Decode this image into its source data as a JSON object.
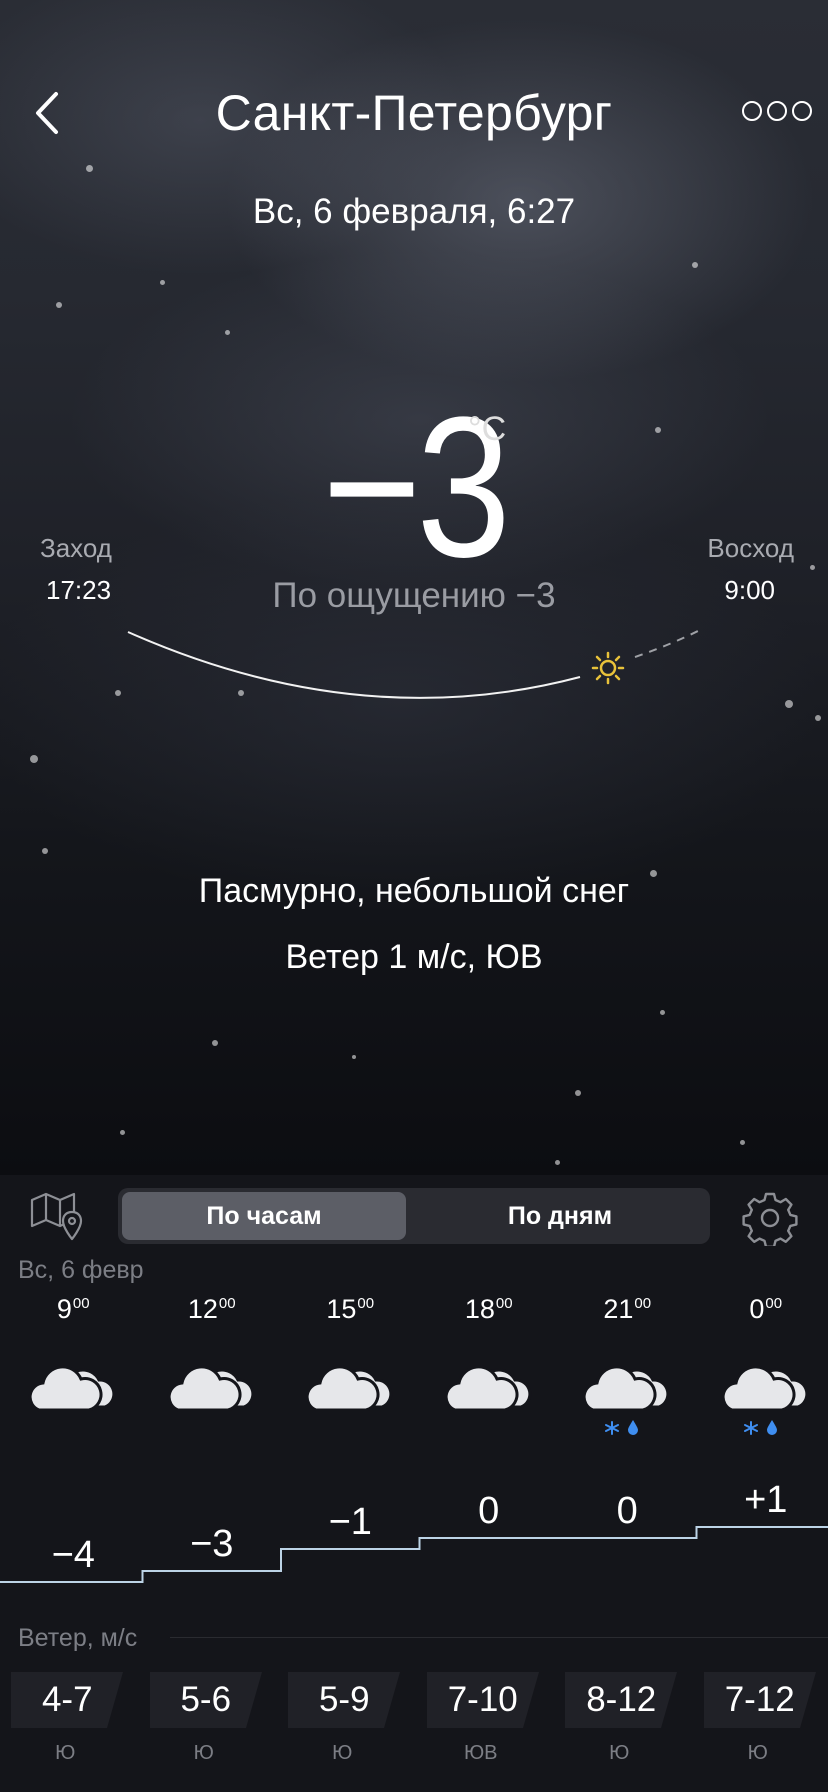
{
  "header": {
    "city": "Санкт-Петербург",
    "datetime": "Вс, 6 февраля, 6:27"
  },
  "current": {
    "temperature": "−3",
    "unit": "°C",
    "feels_like": "По ощущению −3",
    "condition": "Пасмурно, небольшой снег",
    "wind": "Ветер 1 м/с, ЮВ"
  },
  "sun": {
    "sunset_label": "Заход",
    "sunset_time": "17:23",
    "sunrise_label": "Восход",
    "sunrise_time": "9:00"
  },
  "toggle": {
    "hours": "По часам",
    "days": "По дням",
    "active": "hours"
  },
  "day_label": "Вс, 6 февр",
  "hourly": [
    {
      "hour": "9",
      "min": "00",
      "icon": "cloudy-icon",
      "temp": "−4",
      "temp_value": -4
    },
    {
      "hour": "12",
      "min": "00",
      "icon": "cloudy-icon",
      "temp": "−3",
      "temp_value": -3
    },
    {
      "hour": "15",
      "min": "00",
      "icon": "cloudy-icon",
      "temp": "−1",
      "temp_value": -1
    },
    {
      "hour": "18",
      "min": "00",
      "icon": "cloudy-icon",
      "temp": "0",
      "temp_value": 0
    },
    {
      "hour": "21",
      "min": "00",
      "icon": "cloudy-snow-rain-icon",
      "temp": "0",
      "temp_value": 0
    },
    {
      "hour": "0",
      "min": "00",
      "icon": "cloudy-snow-rain-icon",
      "temp": "+1",
      "temp_value": 1
    }
  ],
  "wind_section": {
    "title": "Ветер, м/с",
    "items": [
      {
        "speed": "4-7",
        "dir": "Ю"
      },
      {
        "speed": "5-6",
        "dir": "Ю"
      },
      {
        "speed": "5-9",
        "dir": "Ю"
      },
      {
        "speed": "7-10",
        "dir": "ЮВ"
      },
      {
        "speed": "8-12",
        "dir": "Ю"
      },
      {
        "speed": "7-12",
        "dir": "Ю"
      }
    ]
  },
  "colors": {
    "accent_blue": "#3f8ef0",
    "temp_line": "#bcd3e6",
    "sun": "#e8c23a"
  }
}
